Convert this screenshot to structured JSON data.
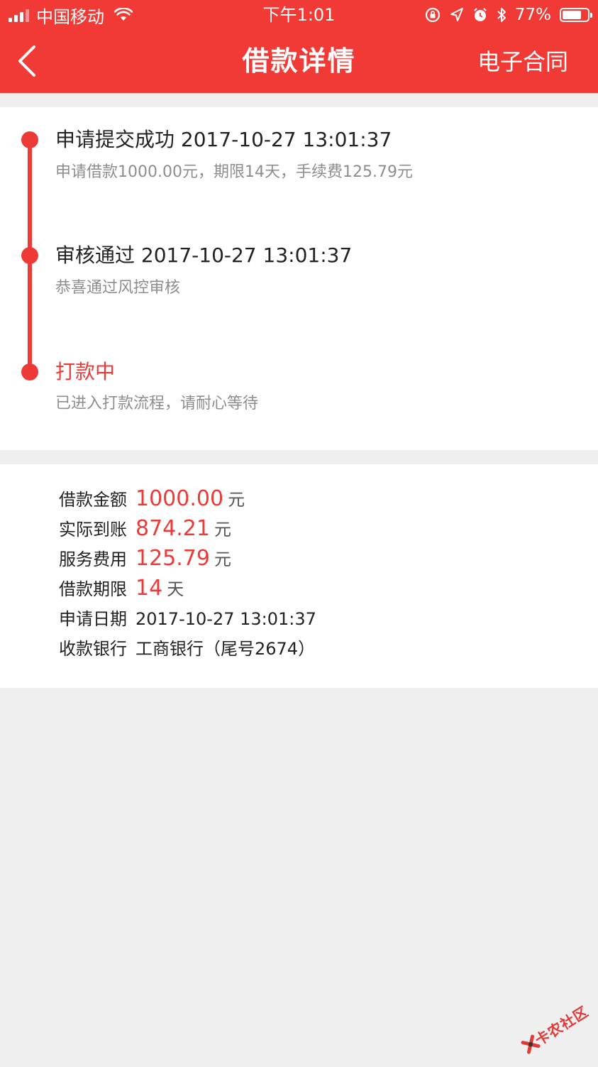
{
  "status_bar": {
    "carrier": "中国移动",
    "time": "下午1:01",
    "battery": "77%",
    "battery_level": 0.77,
    "icons": [
      "signal-icon",
      "wifi-icon",
      "orientation-lock-icon",
      "location-icon",
      "alarm-icon",
      "bluetooth-icon",
      "battery-icon"
    ]
  },
  "nav": {
    "title": "借款详情",
    "contract_label": "电子合同",
    "back_icon": "chevron-left-icon"
  },
  "timeline": {
    "steps": [
      {
        "title": "申请提交成功 2017-10-27 13:01:37",
        "desc": "申请借款1000.00元，期限14天，手续费125.79元",
        "active": false
      },
      {
        "title": "审核通过 2017-10-27 13:01:37",
        "desc": "恭喜通过风控审核",
        "active": false
      },
      {
        "title": "打款中",
        "desc": "已进入打款流程，请耐心等待",
        "active": true
      }
    ]
  },
  "details": {
    "rows": [
      {
        "label": "借款金额",
        "value": "1000.00",
        "unit": "元"
      },
      {
        "label": "实际到账",
        "value": "874.21",
        "unit": "元"
      },
      {
        "label": "服务费用",
        "value": "125.79",
        "unit": "元"
      },
      {
        "label": "借款期限",
        "value": "14",
        "unit": "天"
      },
      {
        "label": "申请日期",
        "value": "2017-10-27 13:01:37"
      },
      {
        "label": "收款银行",
        "value": "工商银行（尾号2674）"
      }
    ]
  },
  "watermark": {
    "text": "卡农社区"
  },
  "colors": {
    "brand_red": "#f13a35",
    "accent_red": "#ee3a36",
    "background": "#efeff0",
    "card": "#ffffff",
    "muted_text": "#8d8d8d"
  }
}
